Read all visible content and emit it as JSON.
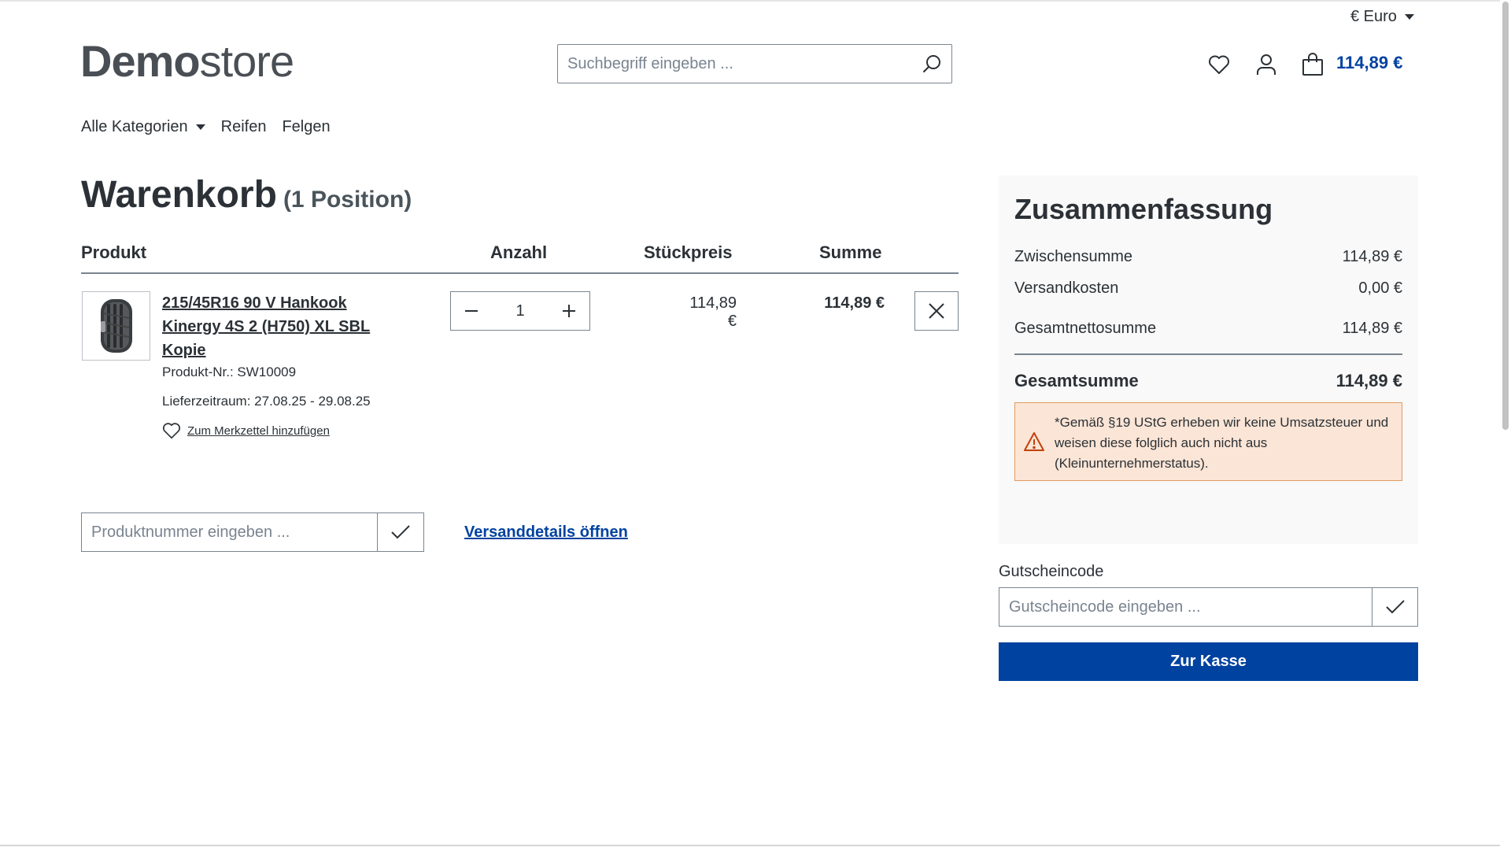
{
  "colors": {
    "brand": "#0042a0",
    "text": "#2b3136",
    "border": "#798490",
    "summary_bg": "#f9f9f9",
    "warning_bg": "#fbe5d6",
    "warning_border": "#e19a62"
  },
  "header": {
    "currency": "€ Euro",
    "logo_bold": "Demo",
    "logo_light": "store",
    "search_placeholder": "Suchbegriff eingeben ...",
    "cart_total": "114,89 €",
    "icons": [
      "heart-icon",
      "user-icon",
      "shopping-bag-icon",
      "search-icon"
    ]
  },
  "nav": {
    "items": [
      {
        "label": "Alle Kategorien",
        "has_dropdown": true
      },
      {
        "label": "Reifen"
      },
      {
        "label": "Felgen"
      }
    ]
  },
  "cart": {
    "title": "Warenkorb",
    "count": "(1 Position)",
    "columns": {
      "product": "Produkt",
      "quantity": "Anzahl",
      "unit_price": "Stückpreis",
      "total": "Summe"
    },
    "items": [
      {
        "name": "215/45R16 90 V Hankook Kinergy 4S 2 (H750) XL SBL Kopie",
        "product_number": "Produkt-Nr.: SW10009",
        "delivery": "Lieferzeitraum: 27.08.25 - 29.08.25",
        "wishlist_label": "Zum Merkzettel hinzufügen",
        "quantity": "1",
        "unit_price": "114,89 €",
        "total": "114,89 €"
      }
    ],
    "product_number_placeholder": "Produktnummer eingeben ...",
    "shipping_link": "Versanddetails öffnen"
  },
  "summary": {
    "title": "Zusammenfassung",
    "subtotal_label": "Zwischensumme",
    "subtotal_value": "114,89 €",
    "shipping_label": "Versandkosten",
    "shipping_value": "0,00 €",
    "net_label": "Gesamtnettosumme",
    "net_value": "114,89 €",
    "total_label": "Gesamtsumme",
    "total_value": "114,89 €",
    "tax_note": "*Gemäß §19 UStG erheben wir keine Umsatzsteuer und weisen diese folglich auch nicht aus (Kleinunternehmerstatus)."
  },
  "voucher": {
    "label": "Gutscheincode",
    "placeholder": "Gutscheincode eingeben ..."
  },
  "checkout": {
    "label": "Zur Kasse"
  }
}
